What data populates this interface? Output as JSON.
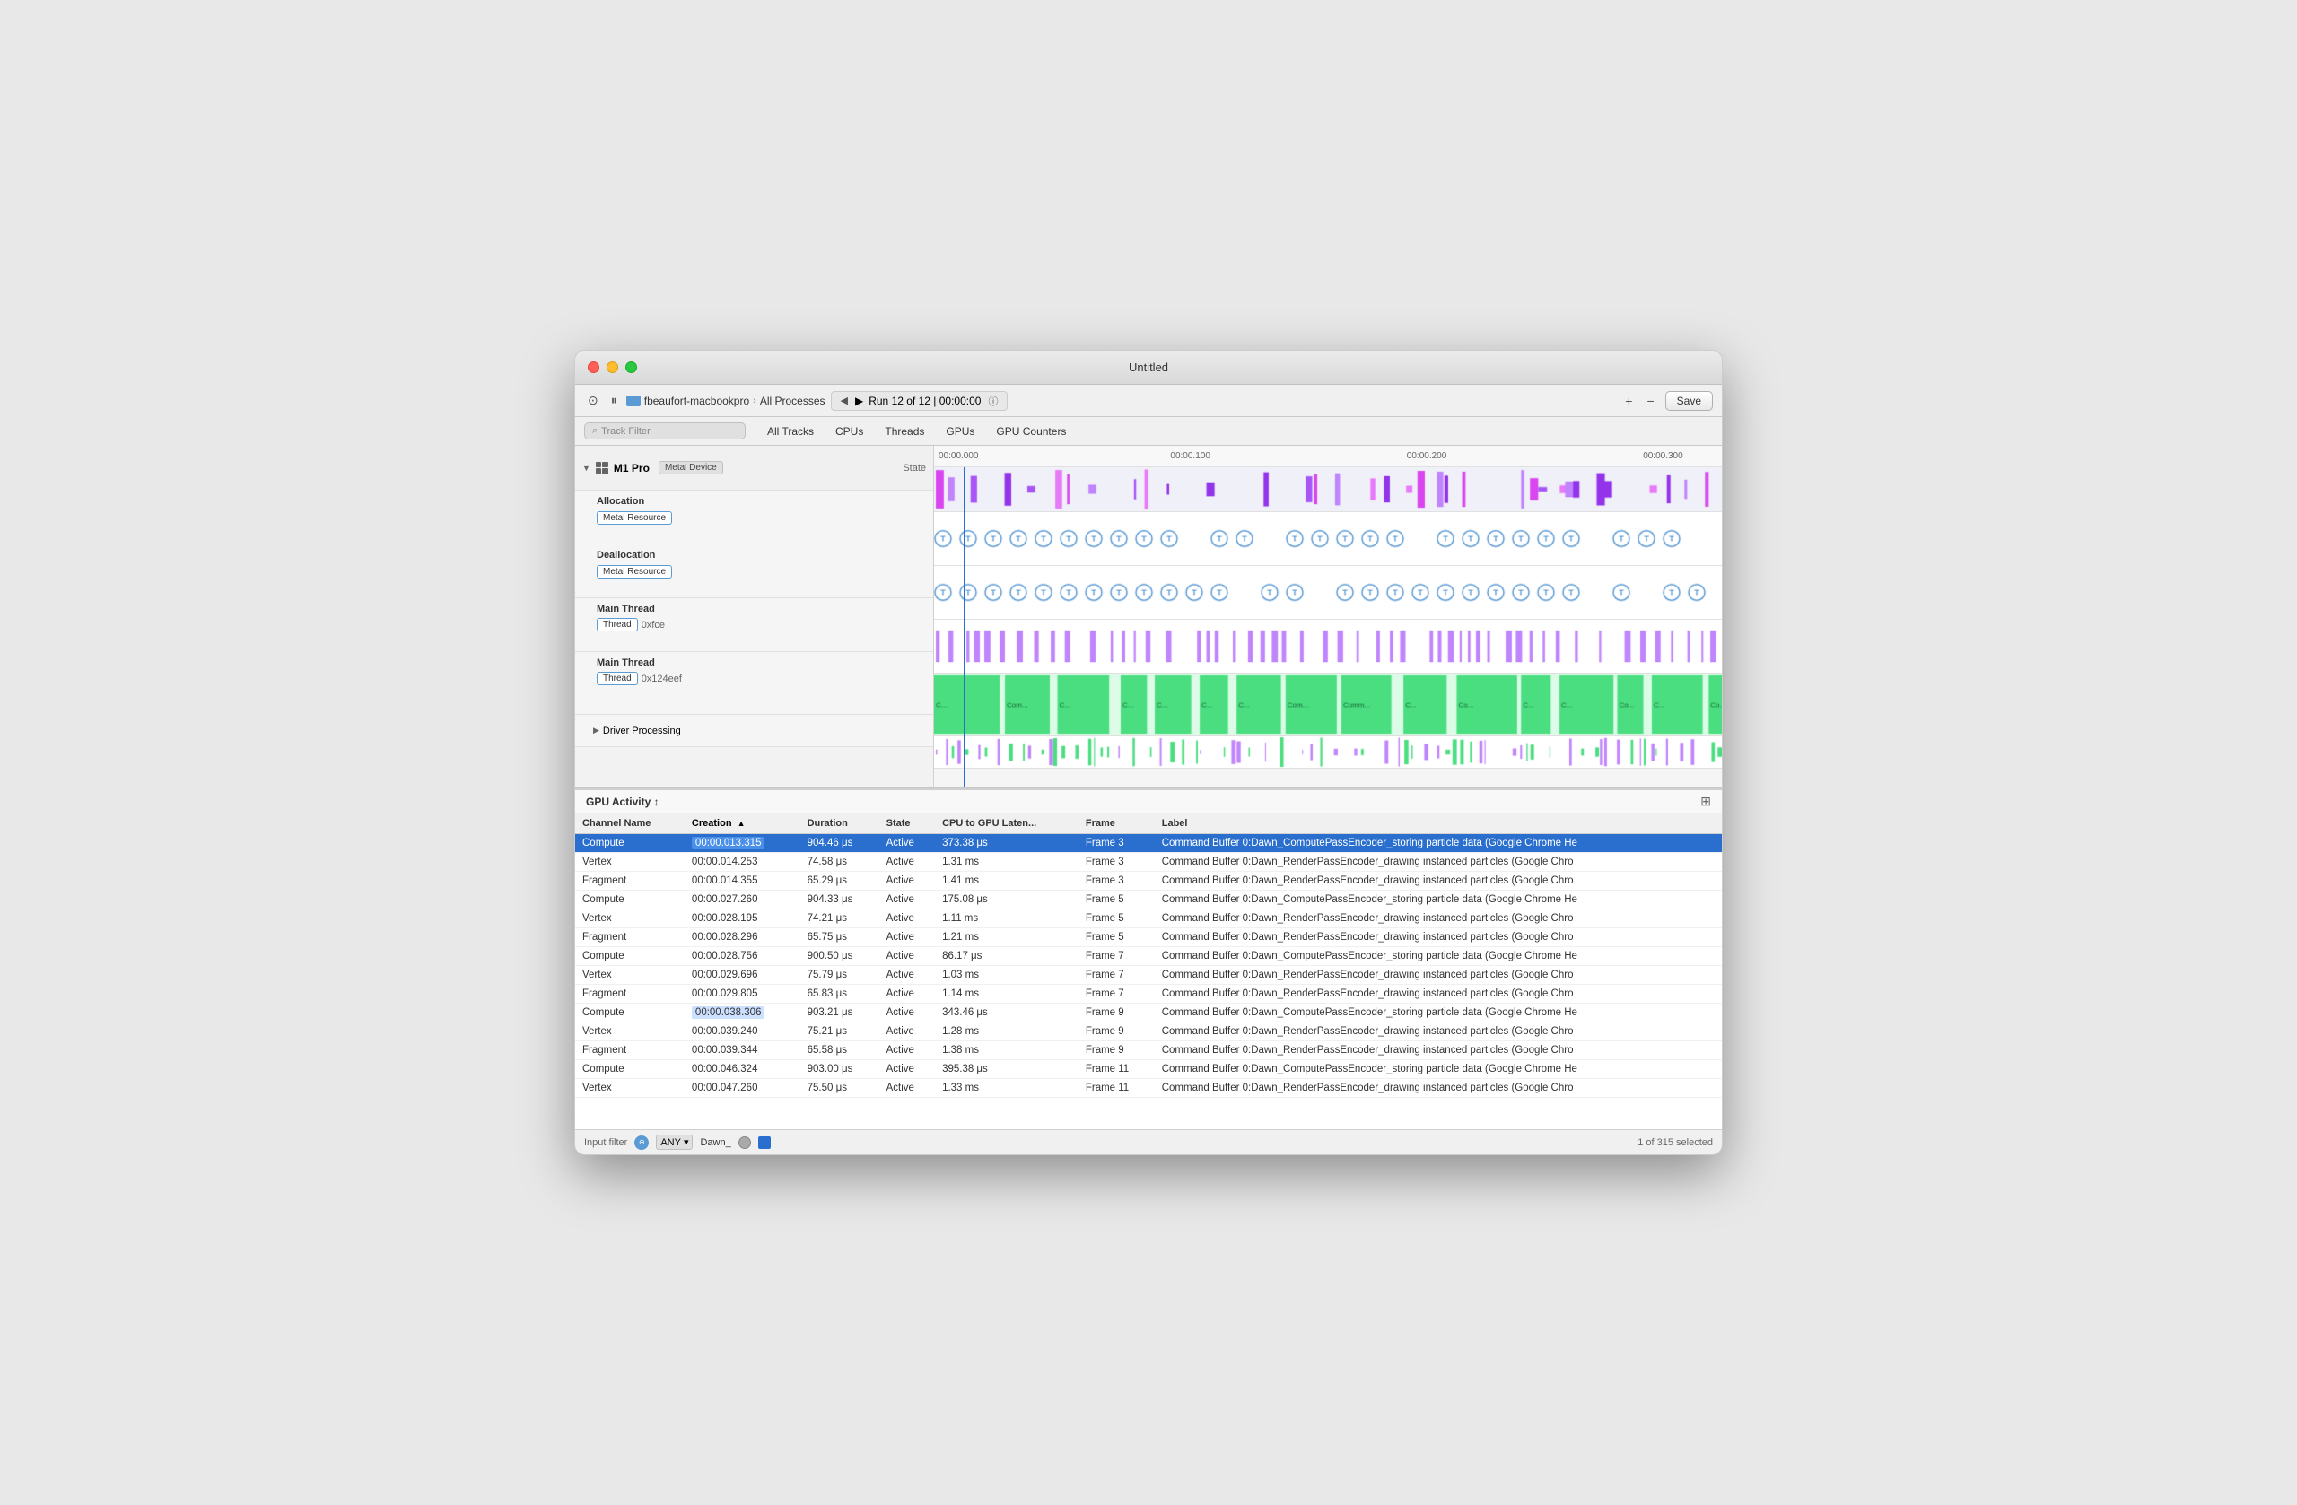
{
  "window": {
    "title": "Untitled"
  },
  "toolbar": {
    "device": "fbeaufort-macbookpro",
    "separator": "›",
    "process": "All Processes",
    "run_info": "Run 12 of 12  |  00:00:00",
    "save_label": "Save",
    "add_label": "+",
    "minus_label": "−"
  },
  "nav_tabs": {
    "search_placeholder": "Track Filter",
    "tabs": [
      "All Tracks",
      "CPUs",
      "Threads",
      "GPUs",
      "GPU Counters"
    ]
  },
  "sidebar": {
    "state_header": "State",
    "m1_pro": "M1 Pro",
    "metal_device_badge": "Metal Device",
    "tracks": [
      {
        "label": "Allocation",
        "badge": "Metal Resource",
        "type": "metal"
      },
      {
        "label": "Deallocation",
        "badge": "Metal Resource",
        "type": "metal"
      },
      {
        "label": "Main Thread",
        "badge": "Thread",
        "sub_badge": "0xfce",
        "type": "thread"
      },
      {
        "label": "Main Thread",
        "badge": "Thread",
        "sub_badge": "0x124eef",
        "type": "thread_green"
      },
      {
        "label": "Driver Processing",
        "type": "driver"
      }
    ]
  },
  "time_ruler": {
    "markers": [
      "00:00.000",
      "00:00.100",
      "00:00.200",
      "00:00.300"
    ]
  },
  "gpu_activity": {
    "title": "GPU Activity ↕",
    "columns": [
      "Channel Name",
      "Creation",
      "Duration",
      "State",
      "CPU to GPU Laten...",
      "Frame",
      "Label"
    ],
    "rows": [
      {
        "channel": "Compute",
        "creation": "00:00.013.315",
        "duration": "904.46 μs",
        "state": "Active",
        "latency": "373.38 μs",
        "frame": "Frame 3",
        "label": "Command Buffer 0:Dawn_ComputePassEncoder_storing particle data   (Google Chrome He",
        "selected": true,
        "highlight_creation": true
      },
      {
        "channel": "Vertex",
        "creation": "00:00.014.253",
        "duration": "74.58 μs",
        "state": "Active",
        "latency": "1.31 ms",
        "frame": "Frame 3",
        "label": "Command Buffer 0:Dawn_RenderPassEncoder_drawing instanced particles   (Google Chro",
        "selected": false
      },
      {
        "channel": "Fragment",
        "creation": "00:00.014.355",
        "duration": "65.29 μs",
        "state": "Active",
        "latency": "1.41 ms",
        "frame": "Frame 3",
        "label": "Command Buffer 0:Dawn_RenderPassEncoder_drawing instanced particles   (Google Chro",
        "selected": false
      },
      {
        "channel": "Compute",
        "creation": "00:00.027.260",
        "duration": "904.33 μs",
        "state": "Active",
        "latency": "175.08 μs",
        "frame": "Frame 5",
        "label": "Command Buffer 0:Dawn_ComputePassEncoder_storing particle data   (Google Chrome He",
        "selected": false
      },
      {
        "channel": "Vertex",
        "creation": "00:00.028.195",
        "duration": "74.21 μs",
        "state": "Active",
        "latency": "1.11 ms",
        "frame": "Frame 5",
        "label": "Command Buffer 0:Dawn_RenderPassEncoder_drawing instanced particles   (Google Chro",
        "selected": false
      },
      {
        "channel": "Fragment",
        "creation": "00:00.028.296",
        "duration": "65.75 μs",
        "state": "Active",
        "latency": "1.21 ms",
        "frame": "Frame 5",
        "label": "Command Buffer 0:Dawn_RenderPassEncoder_drawing instanced particles   (Google Chro",
        "selected": false
      },
      {
        "channel": "Compute",
        "creation": "00:00.028.756",
        "duration": "900.50 μs",
        "state": "Active",
        "latency": "86.17 μs",
        "frame": "Frame 7",
        "label": "Command Buffer 0:Dawn_ComputePassEncoder_storing particle data   (Google Chrome He",
        "selected": false
      },
      {
        "channel": "Vertex",
        "creation": "00:00.029.696",
        "duration": "75.79 μs",
        "state": "Active",
        "latency": "1.03 ms",
        "frame": "Frame 7",
        "label": "Command Buffer 0:Dawn_RenderPassEncoder_drawing instanced particles   (Google Chro",
        "selected": false
      },
      {
        "channel": "Fragment",
        "creation": "00:00.029.805",
        "duration": "65.83 μs",
        "state": "Active",
        "latency": "1.14 ms",
        "frame": "Frame 7",
        "label": "Command Buffer 0:Dawn_RenderPassEncoder_drawing instanced particles   (Google Chro",
        "selected": false
      },
      {
        "channel": "Compute",
        "creation": "00:00.038.306",
        "duration": "903.21 μs",
        "state": "Active",
        "latency": "343.46 μs",
        "frame": "Frame 9",
        "label": "Command Buffer 0:Dawn_ComputePassEncoder_storing particle data   (Google Chrome He",
        "selected": false,
        "highlight_creation": true
      },
      {
        "channel": "Vertex",
        "creation": "00:00.039.240",
        "duration": "75.21 μs",
        "state": "Active",
        "latency": "1.28 ms",
        "frame": "Frame 9",
        "label": "Command Buffer 0:Dawn_RenderPassEncoder_drawing instanced particles   (Google Chro",
        "selected": false
      },
      {
        "channel": "Fragment",
        "creation": "00:00.039.344",
        "duration": "65.58 μs",
        "state": "Active",
        "latency": "1.38 ms",
        "frame": "Frame 9",
        "label": "Command Buffer 0:Dawn_RenderPassEncoder_drawing instanced particles   (Google Chro",
        "selected": false
      },
      {
        "channel": "Compute",
        "creation": "00:00.046.324",
        "duration": "903.00 μs",
        "state": "Active",
        "latency": "395.38 μs",
        "frame": "Frame 11",
        "label": "Command Buffer 0:Dawn_ComputePassEncoder_storing particle data   (Google Chrome He",
        "selected": false
      },
      {
        "channel": "Vertex",
        "creation": "00:00.047.260",
        "duration": "75.50 μs",
        "state": "Active",
        "latency": "1.33 ms",
        "frame": "Frame 11",
        "label": "Command Buffer 0:Dawn_RenderPassEncoder_drawing instanced particles   (Google Chro",
        "selected": false
      }
    ]
  },
  "bottom_bar": {
    "filter_label": "Input filter",
    "any_label": "ANY",
    "filter_value": "Dawn_",
    "selection_info": "1 of 315 selected"
  },
  "colors": {
    "accent_blue": "#2a6fce",
    "purple": "#c084fc",
    "green": "#4ade80",
    "pink": "#f472b6",
    "selected_row": "#2a6fce"
  }
}
